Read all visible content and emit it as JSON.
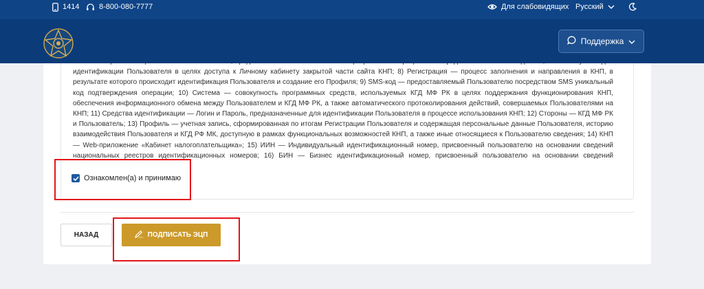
{
  "topbar": {
    "short_number": "1414",
    "hotline": "8-800-080-7777",
    "accessibility_label": "Для слабовидящих",
    "language": "Русский"
  },
  "header": {
    "support_label": "Поддержка"
  },
  "terms": {
    "text": "втайне от третьих лиц символьное обозначение, предоставленное Пользователю в процессе Регистрации или определенное им впоследствии, и используемое для идентификации Пользователя в целях доступа к Личному кабинету закрытой части сайта КНП; 8) Регистрация — процесс заполнения и направления в КНП, в результате которого происходит идентификация Пользователя и создание его Профиля; 9) SMS-код — предоставляемый Пользователю посредством SMS уникальный код подтверждения операции; 10) Система — совокупность программных средств, используемых КГД МФ РК в целях поддержания функционирования КНП, обеспечения информационного обмена между Пользователем и КГД МФ РК, а также автоматического протоколирования действий, совершаемых Пользователями на КНП; 11) Средства идентификации — Логин и Пароль, предназначенные для идентификации Пользователя в процессе использования КНП; 12) Стороны — КГД МФ РК и Пользователь; 13) Профиль — учетная запись, сформированная по итогам Регистрации Пользователя и содержащая персональные данные Пользователя, историю взаимодействия Пользователя и КГД РФ МК, доступную в рамках функциональных возможностей КНП, а также иные относящиеся к Пользователю сведения; 14) КНП — Web-приложение «Кабинет налогоплательщика»; 15) ИИН — Индивидуальный идентификационный номер, присвоенный пользователю на основании сведений национальных реестров идентификационных номеров; 16) БИН — Бизнес идентификационный номер, присвоенный пользователю на основании сведений национальных"
  },
  "agreement": {
    "label": "Ознакомлен(а) и принимаю",
    "checked": true
  },
  "actions": {
    "back_label": "НАЗАД",
    "sign_label": "ПОДПИСАТЬ ЭЦП"
  },
  "colors": {
    "topbar": "#0f4487",
    "header": "#0b3b79",
    "accent_gold": "#cc9a2a",
    "checkbox": "#1d5a9f",
    "highlight": "#e3151b"
  },
  "icons": [
    "phone-icon",
    "headset-icon",
    "eye-icon",
    "chevron-down-icon",
    "moon-icon",
    "chat-icon",
    "pen-icon",
    "check-icon",
    "emblem-logo"
  ]
}
